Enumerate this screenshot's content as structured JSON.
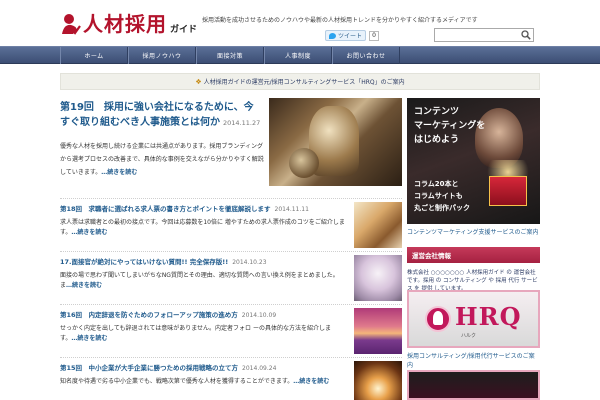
{
  "header": {
    "logo_text": "人材採用",
    "logo_sub": "ガイド",
    "tagline": "採用活動を成功させるためのノウハウや最新の人材採用トレンドを分かりやすく紹介するメディアです",
    "tweet_label": "ツイート",
    "tweet_count": "0",
    "search_placeholder": ""
  },
  "nav": {
    "items": [
      {
        "label": "ホーム"
      },
      {
        "label": "採用ノウハウ"
      },
      {
        "label": "面接対策"
      },
      {
        "label": "人事制度"
      },
      {
        "label": "お問い合わせ"
      }
    ]
  },
  "notice": {
    "text": "人材採用ガイドの運営元/採用コンサルティングサービス「HRQ」のご案内"
  },
  "feature": {
    "title": "第19回　採用に強い会社になるために、今すぐ取り組むべき人事施策とは何か",
    "date": "2014.11.27",
    "excerpt": "優秀な人材を採用し続ける企業には共通点があります。採用ブランディングから選考プロセスの改善まで、具体的な事例を交えながら分かりやすく解説していきます。",
    "more": "…続きを読む"
  },
  "posts": [
    {
      "title": "第18回　求職者に選ばれる求人票の書き方とポイントを徹底解説します",
      "date": "2014.11.11",
      "excerpt": "求人票は求職者との最初の接点です。今回は応募数を10倍に 増やすための求人票作成のコツをご紹介します。",
      "more": "…続きを読む"
    },
    {
      "title": "17.面接官が絶対にやってはいけない質問!! 完全保存版!!",
      "date": "2014.10.23",
      "excerpt": "面接の場で思わず聞いてしまいがちなNG質問とその理由、適切な質問への言い換え例をまとめました。 ま",
      "more": "…続きを読む"
    },
    {
      "title": "第16回　内定辞退を防ぐためのフォローアップ施策の進め方",
      "date": "2014.10.09",
      "excerpt": "せっかく内定を出しても辞退されては意味がありません。内定者フォロ ーの具体的な方法を紹介します。",
      "more": "…続きを読む"
    },
    {
      "title": "第15回　中小企業が大手企業に勝つための採用戦略の立て方",
      "date": "2014.09.24",
      "excerpt": "知名度や待遇で劣る中小企業でも、戦略次第で優秀な人材を獲得することができます。",
      "more": "…続きを読む"
    }
  ],
  "sidebar": {
    "ad_text": "コンテンツ\nマーケティングを\nはじめよう",
    "ad_sub": "コラム20本と\nコラムサイトも\n丸ごと制作パック",
    "link1": "コンテンツマーケティング支援サービスのご案内",
    "section_head": "運営会社情報",
    "section_text": "株式会社 ○○○○○○○ 人材採用ガイド の 運営会社です。採用 の コンサルティング や 採用 代行 サービス を 提供 しています。",
    "hrq_logo": "HRQ",
    "hrq_small": "ハルク",
    "link2": "採用コンサルティング/採用代行サービスのご案内"
  }
}
